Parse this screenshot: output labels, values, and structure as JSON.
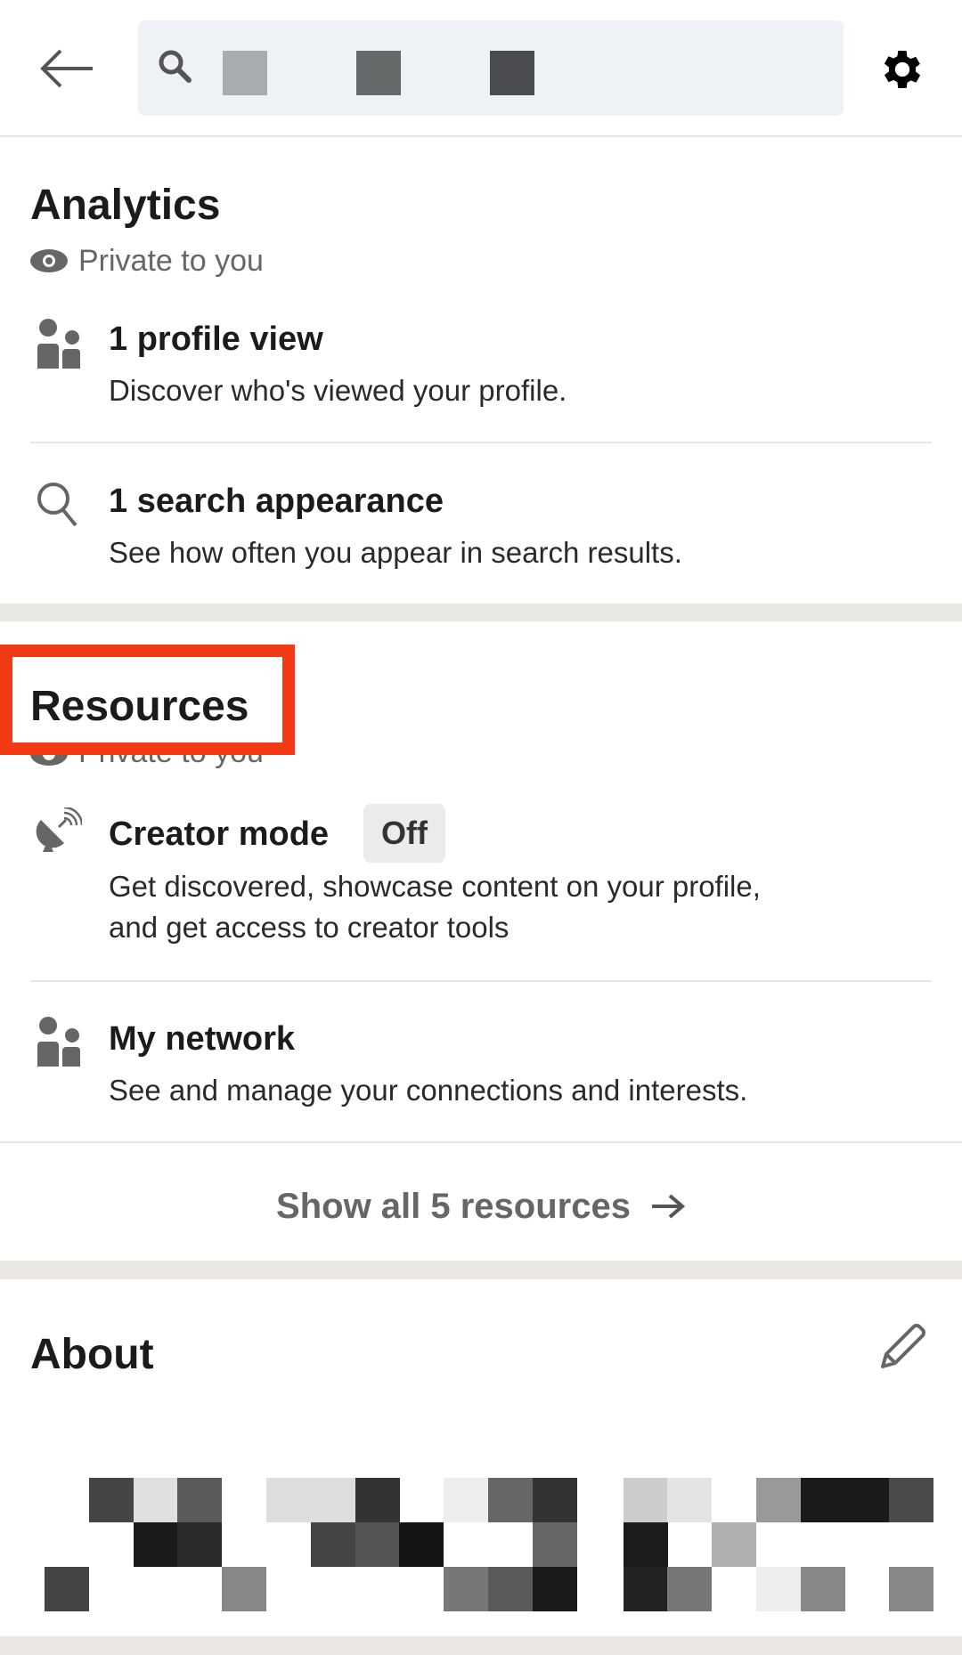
{
  "header": {
    "search_placeholder": "",
    "back_icon": "arrow-left-icon",
    "settings_icon": "gear-icon"
  },
  "analytics": {
    "title": "Analytics",
    "privacy": "Private to you",
    "items": [
      {
        "icon": "people-icon",
        "title": "1 profile view",
        "description": "Discover who's viewed your profile."
      },
      {
        "icon": "search-icon",
        "title": "1 search appearance",
        "description": "See how often you appear in search results."
      }
    ]
  },
  "resources": {
    "title": "Resources",
    "privacy": "Private to you",
    "highlight_color": "#f23a14",
    "items": [
      {
        "icon": "satellite-dish-icon",
        "title": "Creator mode",
        "badge": "Off",
        "description_line1": "Get discovered, showcase content on your profile,",
        "description_line2": "and get access to creator tools"
      },
      {
        "icon": "people-icon",
        "title": "My network",
        "description": "See and manage your connections and interests."
      }
    ],
    "show_all": "Show all 5 resources"
  },
  "about": {
    "title": "About",
    "edit_icon": "pencil-icon"
  }
}
